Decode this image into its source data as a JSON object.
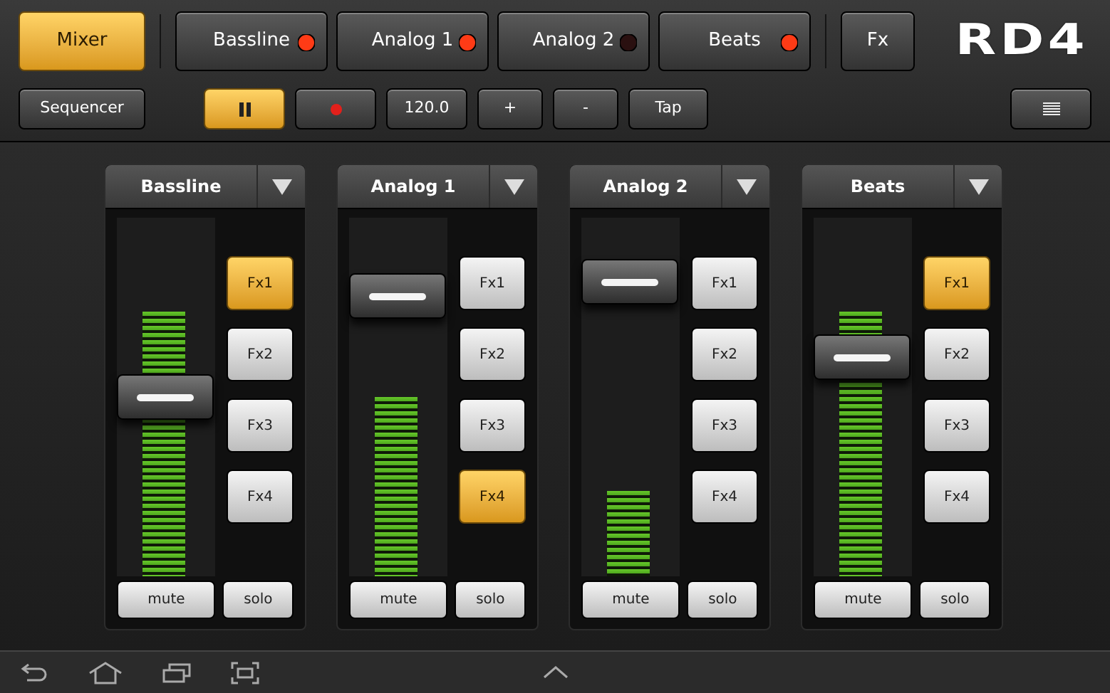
{
  "mode_button": {
    "label": "Mixer",
    "selected": true
  },
  "tracks": [
    {
      "label": "Bassline",
      "led_on": true
    },
    {
      "label": "Analog 1",
      "led_on": true
    },
    {
      "label": "Analog 2",
      "led_on": false
    },
    {
      "label": "Beats",
      "led_on": true
    }
  ],
  "fx_button": {
    "label": "Fx"
  },
  "logo": "RD4",
  "sequencer_button": {
    "label": "Sequencer"
  },
  "transport": [
    {
      "kind": "pause",
      "selected": true
    },
    {
      "kind": "record",
      "selected": false
    }
  ],
  "tempo": "120.0",
  "tempo_buttons": [
    "+",
    "-",
    "Tap"
  ],
  "channels": [
    {
      "name": "Bassline",
      "fader": {
        "level": 0.5
      },
      "meter": {
        "level": 0.74
      },
      "fx": [
        {
          "label": "Fx1",
          "selected": true
        },
        {
          "label": "Fx2",
          "selected": false
        },
        {
          "label": "Fx3",
          "selected": false
        },
        {
          "label": "Fx4",
          "selected": false
        }
      ],
      "mute": "mute",
      "solo": "solo"
    },
    {
      "name": "Analog 1",
      "fader": {
        "level": 0.78
      },
      "meter": {
        "level": 0.5
      },
      "fx": [
        {
          "label": "Fx1",
          "selected": false
        },
        {
          "label": "Fx2",
          "selected": false
        },
        {
          "label": "Fx3",
          "selected": false
        },
        {
          "label": "Fx4",
          "selected": true
        }
      ],
      "mute": "mute",
      "solo": "solo"
    },
    {
      "name": "Analog 2",
      "fader": {
        "level": 0.82
      },
      "meter": {
        "level": 0.24
      },
      "fx": [
        {
          "label": "Fx1",
          "selected": false
        },
        {
          "label": "Fx2",
          "selected": false
        },
        {
          "label": "Fx3",
          "selected": false
        },
        {
          "label": "Fx4",
          "selected": false
        }
      ],
      "mute": "mute",
      "solo": "solo"
    },
    {
      "name": "Beats",
      "fader": {
        "level": 0.61
      },
      "meter": {
        "level": 0.74
      },
      "fx": [
        {
          "label": "Fx1",
          "selected": true
        },
        {
          "label": "Fx2",
          "selected": false
        },
        {
          "label": "Fx3",
          "selected": false
        },
        {
          "label": "Fx4",
          "selected": false
        }
      ],
      "mute": "mute",
      "solo": "solo"
    }
  ]
}
